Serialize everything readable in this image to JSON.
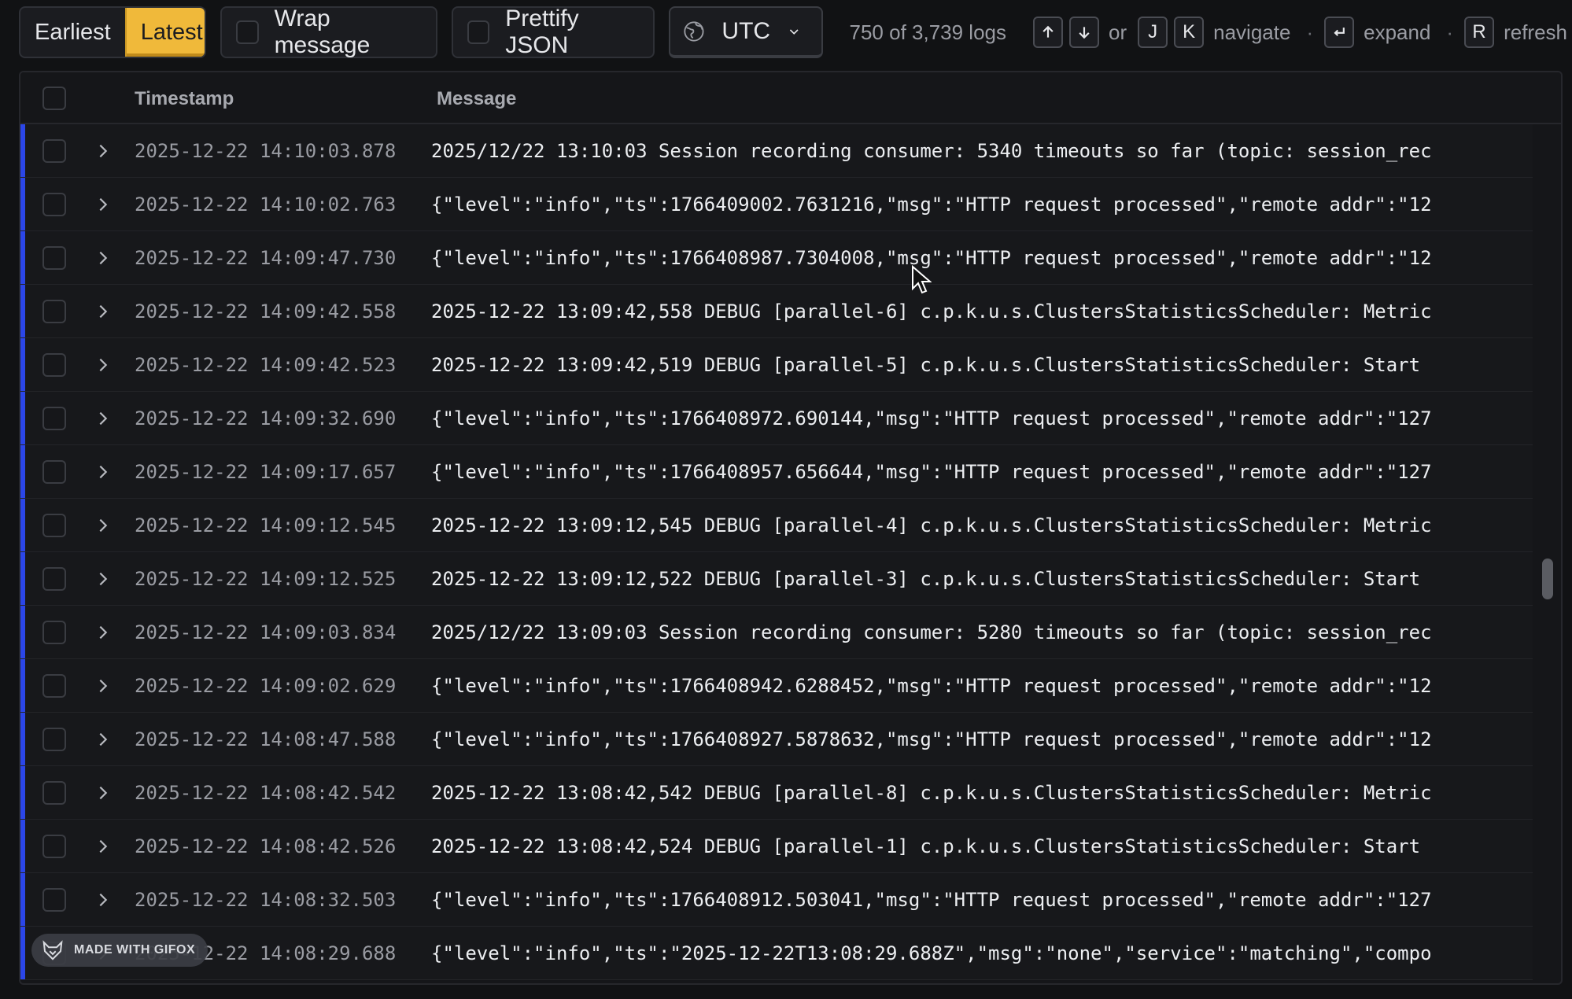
{
  "toolbar": {
    "earliest_label": "Earliest",
    "latest_label": "Latest",
    "wrap_label": "Wrap message",
    "prettify_label": "Prettify JSON",
    "timezone": "UTC",
    "log_count": "750 of 3,739 logs",
    "hints": {
      "or": "or",
      "key_j": "J",
      "key_k": "K",
      "navigate": "navigate",
      "expand": "expand",
      "key_r": "R",
      "refresh": "refresh"
    }
  },
  "table": {
    "col_timestamp": "Timestamp",
    "col_message": "Message",
    "rows": [
      {
        "ts": "2025-12-22 14:10:03.878",
        "msg": "2025/12/22 13:10:03 Session recording consumer: 5340 timeouts so far (topic: session_rec"
      },
      {
        "ts": "2025-12-22 14:10:02.763",
        "msg": "{\"level\":\"info\",\"ts\":1766409002.7631216,\"msg\":\"HTTP request processed\",\"remote addr\":\"12"
      },
      {
        "ts": "2025-12-22 14:09:47.730",
        "msg": "{\"level\":\"info\",\"ts\":1766408987.7304008,\"msg\":\"HTTP request processed\",\"remote addr\":\"12"
      },
      {
        "ts": "2025-12-22 14:09:42.558",
        "msg": "2025-12-22 13:09:42,558 DEBUG [parallel-6] c.p.k.u.s.ClustersStatisticsScheduler: Metric"
      },
      {
        "ts": "2025-12-22 14:09:42.523",
        "msg": "2025-12-22 13:09:42,519 DEBUG [parallel-5] c.p.k.u.s.ClustersStatisticsScheduler: Start"
      },
      {
        "ts": "2025-12-22 14:09:32.690",
        "msg": "{\"level\":\"info\",\"ts\":1766408972.690144,\"msg\":\"HTTP request processed\",\"remote addr\":\"127"
      },
      {
        "ts": "2025-12-22 14:09:17.657",
        "msg": "{\"level\":\"info\",\"ts\":1766408957.656644,\"msg\":\"HTTP request processed\",\"remote addr\":\"127"
      },
      {
        "ts": "2025-12-22 14:09:12.545",
        "msg": "2025-12-22 13:09:12,545 DEBUG [parallel-4] c.p.k.u.s.ClustersStatisticsScheduler: Metric"
      },
      {
        "ts": "2025-12-22 14:09:12.525",
        "msg": "2025-12-22 13:09:12,522 DEBUG [parallel-3] c.p.k.u.s.ClustersStatisticsScheduler: Start"
      },
      {
        "ts": "2025-12-22 14:09:03.834",
        "msg": "2025/12/22 13:09:03 Session recording consumer: 5280 timeouts so far (topic: session_rec"
      },
      {
        "ts": "2025-12-22 14:09:02.629",
        "msg": "{\"level\":\"info\",\"ts\":1766408942.6288452,\"msg\":\"HTTP request processed\",\"remote addr\":\"12"
      },
      {
        "ts": "2025-12-22 14:08:47.588",
        "msg": "{\"level\":\"info\",\"ts\":1766408927.5878632,\"msg\":\"HTTP request processed\",\"remote addr\":\"12"
      },
      {
        "ts": "2025-12-22 14:08:42.542",
        "msg": "2025-12-22 13:08:42,542 DEBUG [parallel-8] c.p.k.u.s.ClustersStatisticsScheduler: Metric"
      },
      {
        "ts": "2025-12-22 14:08:42.526",
        "msg": "2025-12-22 13:08:42,524 DEBUG [parallel-1] c.p.k.u.s.ClustersStatisticsScheduler: Start"
      },
      {
        "ts": "2025-12-22 14:08:32.503",
        "msg": "{\"level\":\"info\",\"ts\":1766408912.503041,\"msg\":\"HTTP request processed\",\"remote addr\":\"127"
      },
      {
        "ts": "2025-12-22 14:08:29.688",
        "msg": "{\"level\":\"info\",\"ts\":\"2025-12-22T13:08:29.688Z\",\"msg\":\"none\",\"service\":\"matching\",\"compo"
      }
    ]
  },
  "watermark": "MADE WITH GIFOX",
  "colors": {
    "accent": "#f0b93a",
    "row_marker": "#2b46e8",
    "background": "#111214"
  }
}
